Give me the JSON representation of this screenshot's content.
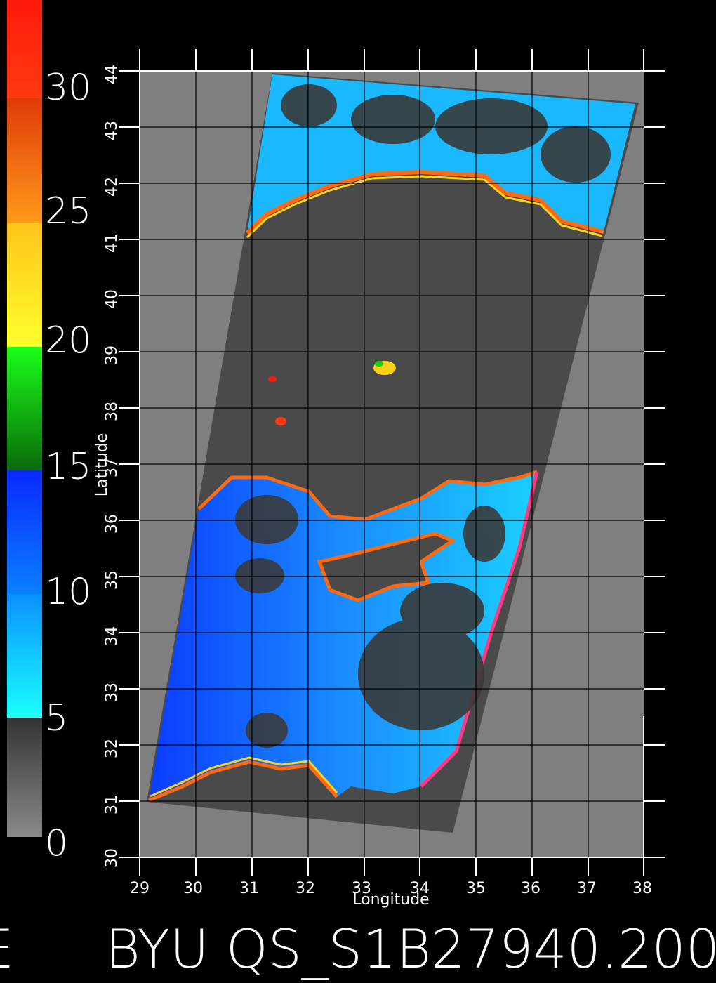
{
  "colorbar": {
    "labels": [
      "30",
      "25",
      "20",
      "15",
      "10",
      "5",
      "0"
    ],
    "colors": {
      "red": "#ff1a0a",
      "orange": "#ff8a1a",
      "yellow": "#ffd21a",
      "green": "#16c91a",
      "blue": "#0a3cff",
      "cyan": "#1ae6ff",
      "gray": "#555555"
    }
  },
  "map": {
    "xlabel": "Longitude",
    "ylabel": "Latitude",
    "xticks": [
      "29",
      "30",
      "31",
      "32",
      "33",
      "34",
      "35",
      "36",
      "37",
      "38"
    ],
    "yticks": [
      "30",
      "31",
      "32",
      "33",
      "34",
      "35",
      "36",
      "37",
      "38",
      "39",
      "40",
      "41",
      "42",
      "43",
      "44"
    ],
    "xlim": [
      29,
      38
    ],
    "ylim": [
      30,
      44
    ],
    "background": "#7f7f7f",
    "swath_color": "#4a4a4a",
    "land_color": "#3a3a3a",
    "sea_color": "#1aa0ff"
  },
  "footer": {
    "left_fragment": "E",
    "title": "BYU QS_S1B27940.200"
  }
}
